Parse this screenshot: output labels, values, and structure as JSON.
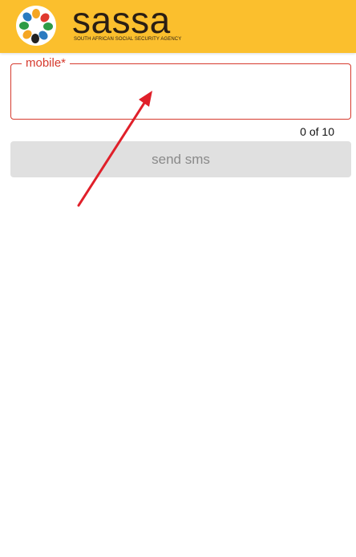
{
  "header": {
    "brand_name": "sassa",
    "brand_subtitle": "SOUTH AFRICAN SOCIAL SECURITY AGENCY",
    "background_color": "#fbbf2d",
    "logo_icon": "sassa-hands-logo-icon"
  },
  "form": {
    "mobile_label": "mobile*",
    "mobile_value": "",
    "counter": "0 of 10",
    "send_label": "send sms",
    "accent_color": "#d63a2e"
  },
  "annotation": {
    "arrow_color": "#e0202a",
    "arrow_icon": "red-arrow-annotation"
  }
}
